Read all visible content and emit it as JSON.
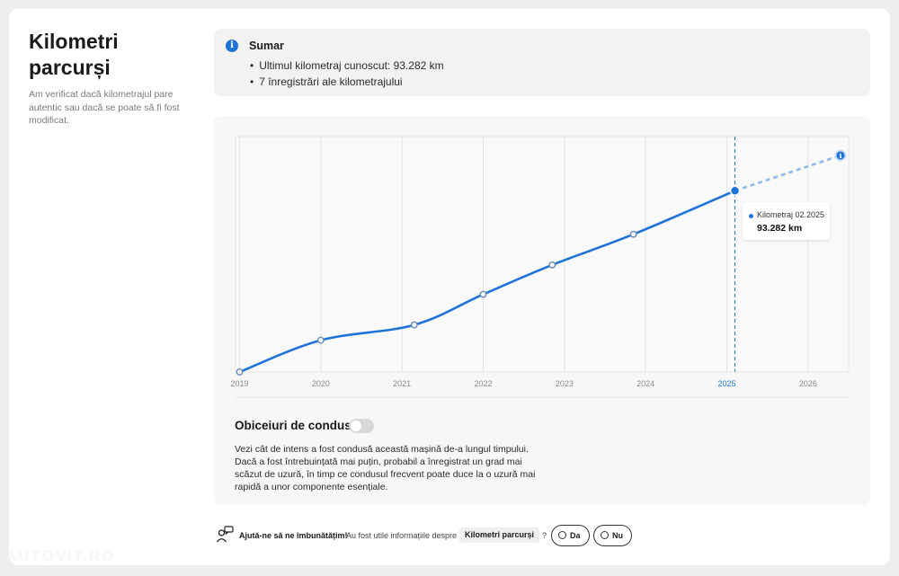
{
  "header": {
    "title": "Kilometri parcurși",
    "description": "Am verificat dacă kilometrajul pare autentic sau dacă se poate să fi fost modificat."
  },
  "summary": {
    "title": "Sumar",
    "items": [
      "Ultimul kilometraj cunoscut: 93.282 km",
      "7 înregistrări ale kilometrajului"
    ]
  },
  "chart_data": {
    "type": "line",
    "x_ticks": [
      "2019",
      "2020",
      "2021",
      "2022",
      "2023",
      "2024",
      "2025",
      "2026"
    ],
    "highlight_tick": "2025",
    "points": [
      {
        "x": 2019.0,
        "y": 0
      },
      {
        "x": 2020.0,
        "y": 13500
      },
      {
        "x": 2021.15,
        "y": 20000
      },
      {
        "x": 2022.0,
        "y": 33000
      },
      {
        "x": 2022.85,
        "y": 45500
      },
      {
        "x": 2023.85,
        "y": 58500
      },
      {
        "x": 2025.1,
        "y": 77000
      }
    ],
    "projection": {
      "x": 2026.4,
      "y": 92000
    },
    "xlim": [
      2018.95,
      2026.5
    ],
    "ylim": [
      0,
      100000
    ],
    "grid": true,
    "colors": {
      "line": "#1e73d8",
      "projection": "#8fbbec",
      "highlight": "#1e73d8"
    },
    "tooltip": {
      "label": "Kilometraj 02.2025",
      "value": "93.282 km"
    }
  },
  "habits": {
    "title": "Obiceiuri de condus",
    "toggle_on": false,
    "text": "Vezi cât de intens a fost condusă această mașină de-a lungul timpului. Dacă a fost întrebuințată mai puțin, probabil a înregistrat un grad mai scăzut de uzură, în timp ce condusul frecvent poate duce la o uzură mai rapidă a unor componente esențiale."
  },
  "feedback": {
    "bold": "Ajută-ne să ne îmbunătățim!",
    "question": "Au fost utile informațiile despre",
    "chip": "Kilometri parcurși",
    "question_end": "?",
    "yes": "Da",
    "no": "Nu"
  },
  "watermark": "AUTOVIT.RO"
}
